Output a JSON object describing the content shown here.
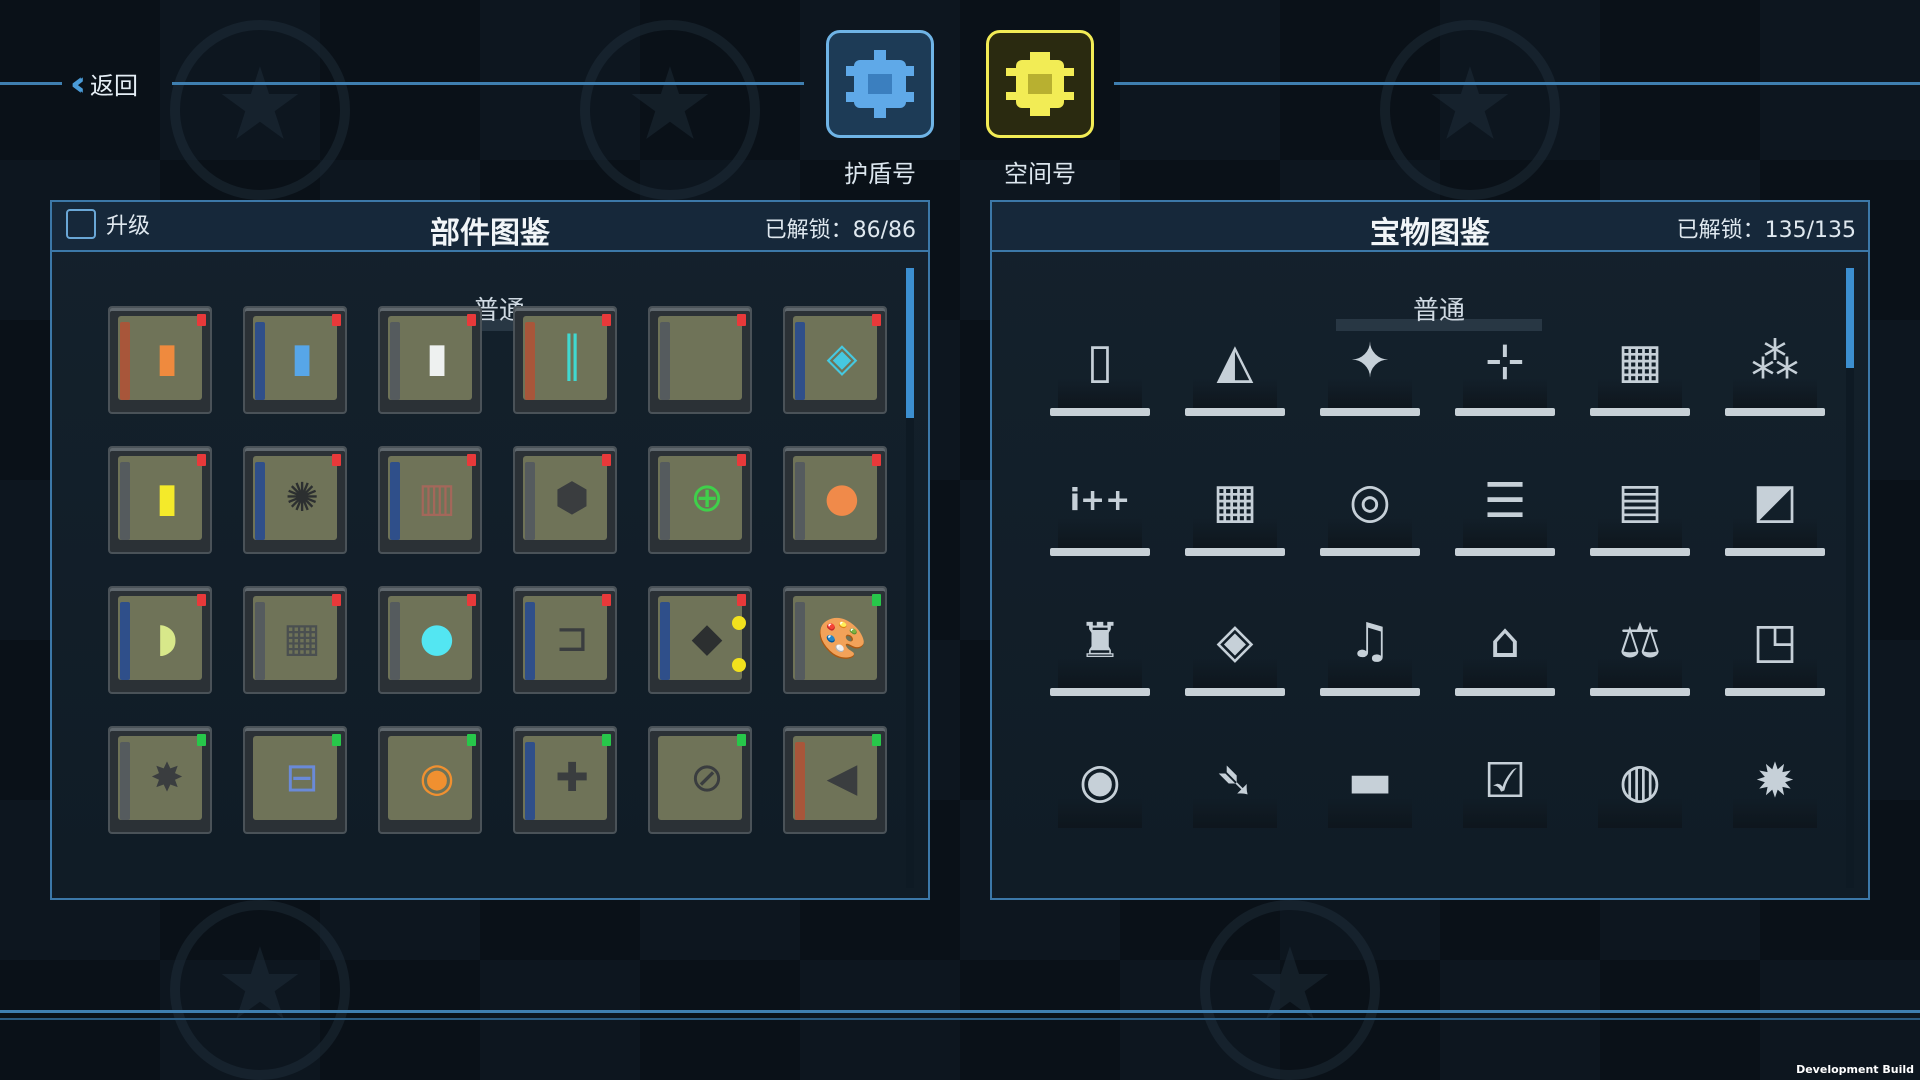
{
  "nav": {
    "back_label": "返回"
  },
  "ships": [
    {
      "label": "护盾号",
      "color": "#5fa9e8",
      "icon": "shield-ship-icon"
    },
    {
      "label": "空间号",
      "color": "#f2ec55",
      "icon": "space-ship-icon",
      "selected": true
    }
  ],
  "parts_panel": {
    "title": "部件图鉴",
    "upgrade_label": "升级",
    "unlock_text": "已解锁：86/86",
    "section": "普通"
  },
  "treasure_panel": {
    "title": "宝物图鉴",
    "unlock_text": "已解锁：135/135",
    "section": "普通"
  },
  "parts": [
    {
      "stripe": "#a8563a",
      "glyph": "▮",
      "glyph_color": "#ef8a3e",
      "ind": "#e8393a"
    },
    {
      "stripe": "#2f4f8a",
      "glyph": "▮",
      "glyph_color": "#57a6e8",
      "ind": "#e8393a"
    },
    {
      "stripe": "#555b5e",
      "glyph": "▮",
      "glyph_color": "#eef1f0",
      "ind": "#e8393a"
    },
    {
      "stripe": "#a8563a",
      "glyph": "║",
      "glyph_color": "#40d8d0",
      "ind": "#e8393a"
    },
    {
      "stripe": "#555b5e",
      "glyph": "",
      "glyph_color": "#6f7358",
      "ind": "#e8393a"
    },
    {
      "stripe": "#2f4f8a",
      "glyph": "◈",
      "glyph_color": "#46c8e0",
      "ind": "#e8393a"
    },
    {
      "stripe": "#555b5e",
      "glyph": "▮",
      "glyph_color": "#f4ea2a",
      "ind": "#e8393a"
    },
    {
      "stripe": "#2f4f8a",
      "glyph": "✺",
      "glyph_color": "#2c2f30",
      "ind": "#e8393a"
    },
    {
      "stripe": "#2f4f8a",
      "glyph": "▥",
      "glyph_color": "#a4675a",
      "ind": "#e8393a"
    },
    {
      "stripe": "#555b5e",
      "glyph": "⬢",
      "glyph_color": "#3a3d3f",
      "ind": "#e8393a"
    },
    {
      "stripe": "#555b5e",
      "glyph": "⊕",
      "glyph_color": "#3fd04a",
      "ind": "#e8393a"
    },
    {
      "stripe": "#555b5e",
      "glyph": "●",
      "glyph_color": "#f08a4a",
      "ind": "#e8393a"
    },
    {
      "stripe": "#2f4f8a",
      "glyph": "◗",
      "glyph_color": "#d8e88a",
      "ind": "#e8393a"
    },
    {
      "stripe": "#555b5e",
      "glyph": "▦",
      "glyph_color": "#4a4f50",
      "ind": "#e8393a"
    },
    {
      "stripe": "#555b5e",
      "glyph": "●",
      "glyph_color": "#53e6f2",
      "ind": "#e8393a"
    },
    {
      "stripe": "#2f4f8a",
      "glyph": "⊐",
      "glyph_color": "#3a3d3f",
      "ind": "#e8393a"
    },
    {
      "stripe": "#2f4f8a",
      "glyph": "◆",
      "glyph_color": "#2c2f30",
      "ind": "#e8393a",
      "dots": true
    },
    {
      "stripe": "#555b5e",
      "glyph": "🎨",
      "glyph_color": "#3a3d3f",
      "ind": "#27c74a"
    },
    {
      "stripe": "#555b5e",
      "glyph": "✸",
      "glyph_color": "#3a3d3f",
      "ind": "#27c74a"
    },
    {
      "stripe": "",
      "glyph": "⊟",
      "glyph_color": "#6a8ad8",
      "ind": "#27c74a"
    },
    {
      "stripe": "",
      "glyph": "◉",
      "glyph_color": "#f09030",
      "ind": "#27c74a"
    },
    {
      "stripe": "#2f4f8a",
      "glyph": "✚",
      "glyph_color": "#3a3d3f",
      "ind": "#27c74a"
    },
    {
      "stripe": "",
      "glyph": "⊘",
      "glyph_color": "#3a3d3f",
      "ind": "#27c74a"
    },
    {
      "stripe": "#a8563a",
      "glyph": "◀",
      "glyph_color": "#3a3d3f",
      "ind": "#27c74a"
    }
  ],
  "treasures": [
    {
      "glyph": "▯",
      "icon": "card-icon"
    },
    {
      "glyph": "◭",
      "icon": "prism-icon"
    },
    {
      "glyph": "✦",
      "icon": "star-icon"
    },
    {
      "glyph": "⊹",
      "icon": "axis-icon"
    },
    {
      "glyph": "▦",
      "icon": "solar-panel-icon"
    },
    {
      "glyph": "⁂",
      "icon": "fireworks-icon"
    },
    {
      "glyph": "i++",
      "icon": "code-icon"
    },
    {
      "glyph": "▦",
      "icon": "grid-icon"
    },
    {
      "glyph": "◎",
      "icon": "target-icon"
    },
    {
      "glyph": "☰",
      "icon": "coins-icon"
    },
    {
      "glyph": "▤",
      "icon": "magazine-icon"
    },
    {
      "glyph": "◩",
      "icon": "glass-icon"
    },
    {
      "glyph": "♜",
      "icon": "lighthouse-icon"
    },
    {
      "glyph": "◈",
      "icon": "wrapper-icon"
    },
    {
      "glyph": "♫",
      "icon": "guitar-icon"
    },
    {
      "glyph": "⌂",
      "icon": "laptop-icon"
    },
    {
      "glyph": "⚖",
      "icon": "scale-icon"
    },
    {
      "glyph": "◳",
      "icon": "ice-cube-icon"
    },
    {
      "glyph": "◉",
      "icon": "disc-icon"
    },
    {
      "glyph": "➴",
      "icon": "kunai-icon"
    },
    {
      "glyph": "▬",
      "icon": "skateboard-icon"
    },
    {
      "glyph": "☑",
      "icon": "clipboard-icon"
    },
    {
      "glyph": "◍",
      "icon": "vortex-card-icon"
    },
    {
      "glyph": "✹",
      "icon": "spiked-device-icon"
    }
  ],
  "footer": {
    "dev_build": "Development Build"
  }
}
